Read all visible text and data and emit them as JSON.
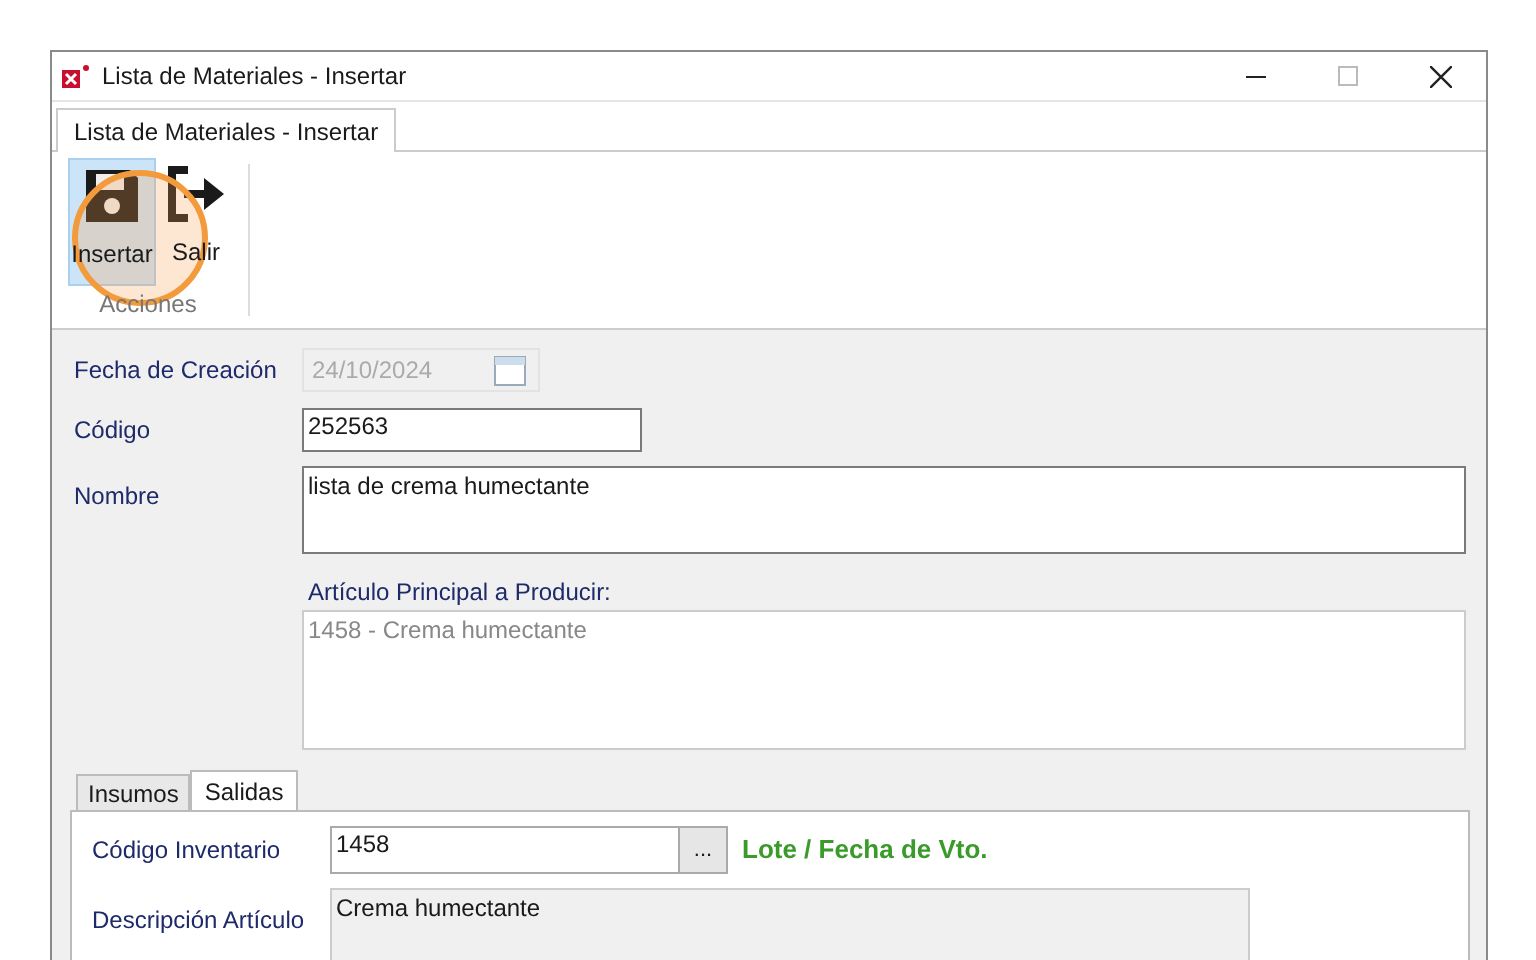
{
  "window": {
    "title": "Lista de Materiales - Insertar"
  },
  "ribbon": {
    "tabs": [
      {
        "label": "Lista de Materiales - Insertar",
        "selected": true
      }
    ],
    "group": {
      "label": "Acciones",
      "buttons": [
        {
          "kind": "save",
          "label": "Insertar",
          "selected": true
        },
        {
          "kind": "exit",
          "label": "Salir",
          "selected": false
        }
      ]
    }
  },
  "form": {
    "fecha_creacion": {
      "label": "Fecha de Creación",
      "value": "24/10/2024",
      "disabled": true
    },
    "codigo": {
      "label": "Código",
      "value": "252563"
    },
    "nombre": {
      "label": "Nombre",
      "value": "lista de crema humectante"
    },
    "articulo_principal": {
      "label": "Artículo Principal a Producir:",
      "value": "1458 - Crema humectante"
    }
  },
  "tabs": [
    {
      "label": "Insumos",
      "selected": false
    },
    {
      "label": "Salidas",
      "selected": true
    }
  ],
  "salidas": {
    "codigo_inventario": {
      "label": "Código Inventario",
      "value": "1458",
      "button": "..."
    },
    "lote_link": "Lote / Fecha de Vto.",
    "descripcion": {
      "label": "Descripción Artículo",
      "value": "Crema humectante"
    }
  }
}
